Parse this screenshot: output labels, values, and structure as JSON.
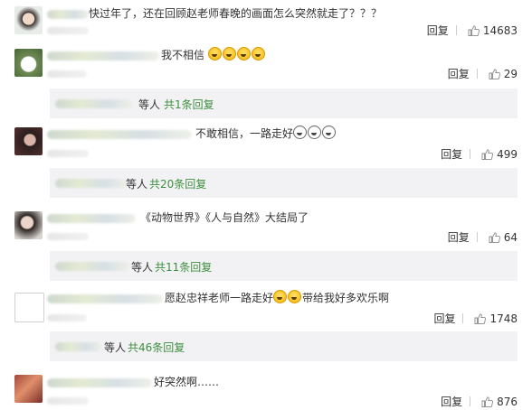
{
  "comments": [
    {
      "text": "快过年了，还在回顾赵老师春晚的画面怎么突然就走了？？？",
      "reply": "回复",
      "likes": "14683"
    },
    {
      "text": "我不相信",
      "emoji_count": 4,
      "reply": "回复",
      "likes": "29",
      "thread": {
        "prefix": "等人",
        "summary": "共1条回复"
      }
    },
    {
      "text": "不敢相信，一路走好",
      "emoji_count": 3,
      "reply": "回复",
      "likes": "499",
      "thread": {
        "prefix": "等人",
        "summary": "共20条回复"
      }
    },
    {
      "text": "《动物世界》《人与自然》大结局了",
      "reply": "回复",
      "likes": "64",
      "thread": {
        "prefix": "等人",
        "summary": "共11条回复"
      }
    },
    {
      "text_a": "愿赵忠祥老师一路走好",
      "text_b": "带给我好多欢乐啊",
      "reply": "回复",
      "likes": "1748",
      "thread": {
        "prefix": "等人",
        "summary": "共46条回复"
      }
    },
    {
      "text": "好突然啊……",
      "reply": "回复",
      "likes": "876"
    }
  ],
  "icons": {
    "like": "thumbs-up-icon",
    "emoji": "crying-face-icon"
  },
  "colors": {
    "link_green": "#3e8f3e",
    "thread_bg": "#f2f2f5",
    "text": "#333333"
  }
}
